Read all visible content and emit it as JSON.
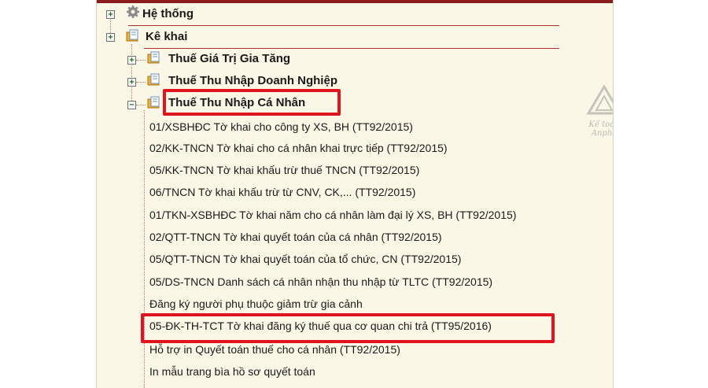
{
  "tree": {
    "he_thong": "Hệ thống",
    "ke_khai": "Kê khai",
    "categories": [
      "Thuế Giá Trị Gia Tăng",
      "Thuế Thu Nhập Doanh Nghiệp",
      "Thuế Thu Nhập Cá Nhân"
    ],
    "items": [
      "01/XSBHĐC Tờ khai cho công ty XS, BH (TT92/2015)",
      "02/KK-TNCN Tờ khai cho cá nhân khai trực tiếp (TT92/2015)",
      "05/KK-TNCN Tờ khai khấu trừ thuế TNCN (TT92/2015)",
      "06/TNCN Tờ khai khấu trừ từ CNV, CK,... (TT92/2015)",
      "01/TKN-XSBHĐC Tờ khai năm cho cá nhân làm đại lý XS, BH (TT92/2015)",
      "02/QTT-TNCN Tờ khai quyết toán của cá nhân (TT92/2015)",
      "05/QTT-TNCN Tờ khai quyết toán của tổ chức, CN (TT92/2015)",
      "05/DS-TNCN Danh sách cá nhân nhận thu nhập từ TLTC (TT92/2015)",
      "Đăng ký người phụ thuộc giảm trừ gia cảnh",
      "05-ĐK-TH-TCT Tờ khai đăng ký thuế qua cơ quan chi trả (TT95/2016)",
      "Hỗ trợ in Quyết toán thuế cho cá nhân (TT92/2015)",
      "In mẫu trang bìa hồ sơ quyết toán"
    ]
  },
  "watermark": {
    "text": "Kế toán Anpha"
  },
  "colors": {
    "highlight": "#e0141e",
    "tree_line": "#d07070",
    "background": "#faf7e6"
  }
}
